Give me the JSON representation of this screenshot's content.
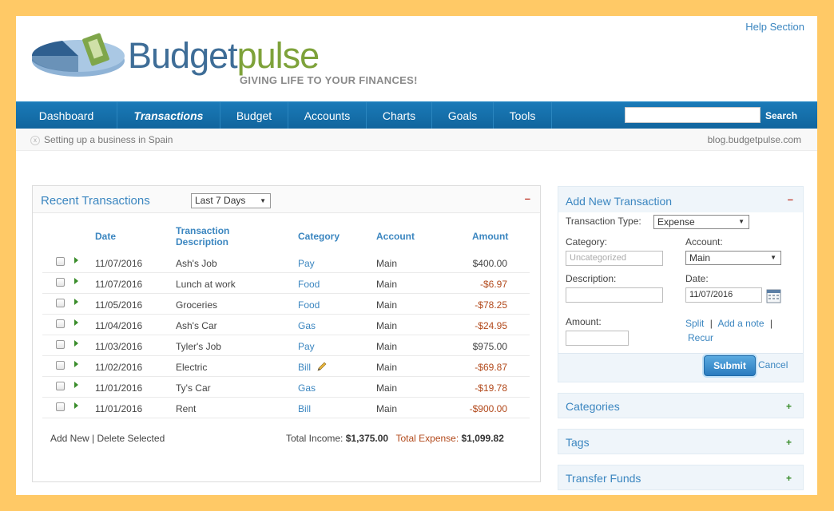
{
  "header": {
    "brand_part1": "Budget",
    "brand_part2": "pulse",
    "tagline": "GIVING LIFE TO YOUR FINANCES!",
    "help_link": "Help Section"
  },
  "nav": {
    "items": [
      {
        "label": "Dashboard"
      },
      {
        "label": "Transactions"
      },
      {
        "label": "Budget"
      },
      {
        "label": "Accounts"
      },
      {
        "label": "Charts"
      },
      {
        "label": "Goals"
      },
      {
        "label": "Tools"
      }
    ],
    "active": "Transactions",
    "search_label": "Search",
    "search_value": ""
  },
  "infobar": {
    "close_glyph": "x",
    "message": "Setting up a business in Spain",
    "blog": "blog.budgetpulse.com"
  },
  "recent": {
    "title": "Recent Transactions",
    "range": "Last 7 Days",
    "minimize": "–",
    "columns": {
      "date": "Date",
      "desc_1": "Transaction",
      "desc_2": "Description",
      "category": "Category",
      "account": "Account",
      "amount": "Amount"
    },
    "rows": [
      {
        "date": "11/07/2016",
        "desc": "Ash's Job",
        "category": "Pay",
        "account": "Main",
        "amount": "$400.00"
      },
      {
        "date": "11/07/2016",
        "desc": "Lunch at work",
        "category": "Food",
        "account": "Main",
        "amount": "-$6.97"
      },
      {
        "date": "11/05/2016",
        "desc": "Groceries",
        "category": "Food",
        "account": "Main",
        "amount": "-$78.25"
      },
      {
        "date": "11/04/2016",
        "desc": "Ash's Car",
        "category": "Gas",
        "account": "Main",
        "amount": "-$24.95"
      },
      {
        "date": "11/03/2016",
        "desc": "Tyler's Job",
        "category": "Pay",
        "account": "Main",
        "amount": "$975.00"
      },
      {
        "date": "11/02/2016",
        "desc": "Electric",
        "category": "Bill",
        "account": "Main",
        "amount": "-$69.87"
      },
      {
        "date": "11/01/2016",
        "desc": "Ty's Car",
        "category": "Gas",
        "account": "Main",
        "amount": "-$19.78"
      },
      {
        "date": "11/01/2016",
        "desc": "Rent",
        "category": "Bill",
        "account": "Main",
        "amount": "-$900.00"
      }
    ],
    "footer": {
      "add_new": "Add New",
      "separator": "|",
      "delete_selected": "Delete Selected",
      "income_label": "Total Income:",
      "income_value": "$1,375.00",
      "expense_label": "Total Expense:",
      "expense_value": "$1,099.82"
    }
  },
  "add_transaction": {
    "title": "Add New Transaction",
    "minimize": "–",
    "type_label": "Transaction Type:",
    "type_value": "Expense",
    "category_label": "Category:",
    "category_placeholder": "Uncategorized",
    "account_label": "Account:",
    "account_value": "Main",
    "description_label": "Description:",
    "date_label": "Date:",
    "date_value": "11/07/2016",
    "amount_label": "Amount:",
    "split": "Split",
    "add_note": "Add a note",
    "recur": "Recur",
    "link_sep": "|",
    "submit": "Submit",
    "cancel": "Cancel"
  },
  "side_panels": [
    {
      "title": "Categories",
      "toggle": "+"
    },
    {
      "title": "Tags",
      "toggle": "+"
    },
    {
      "title": "Transfer Funds",
      "toggle": "+"
    }
  ],
  "colors": {
    "page_bg": "#ffc966",
    "nav_blue": "#1a7ab8",
    "link_blue": "#3b86c0",
    "negative": "#b2491b",
    "brand_green": "#7ea23a"
  }
}
